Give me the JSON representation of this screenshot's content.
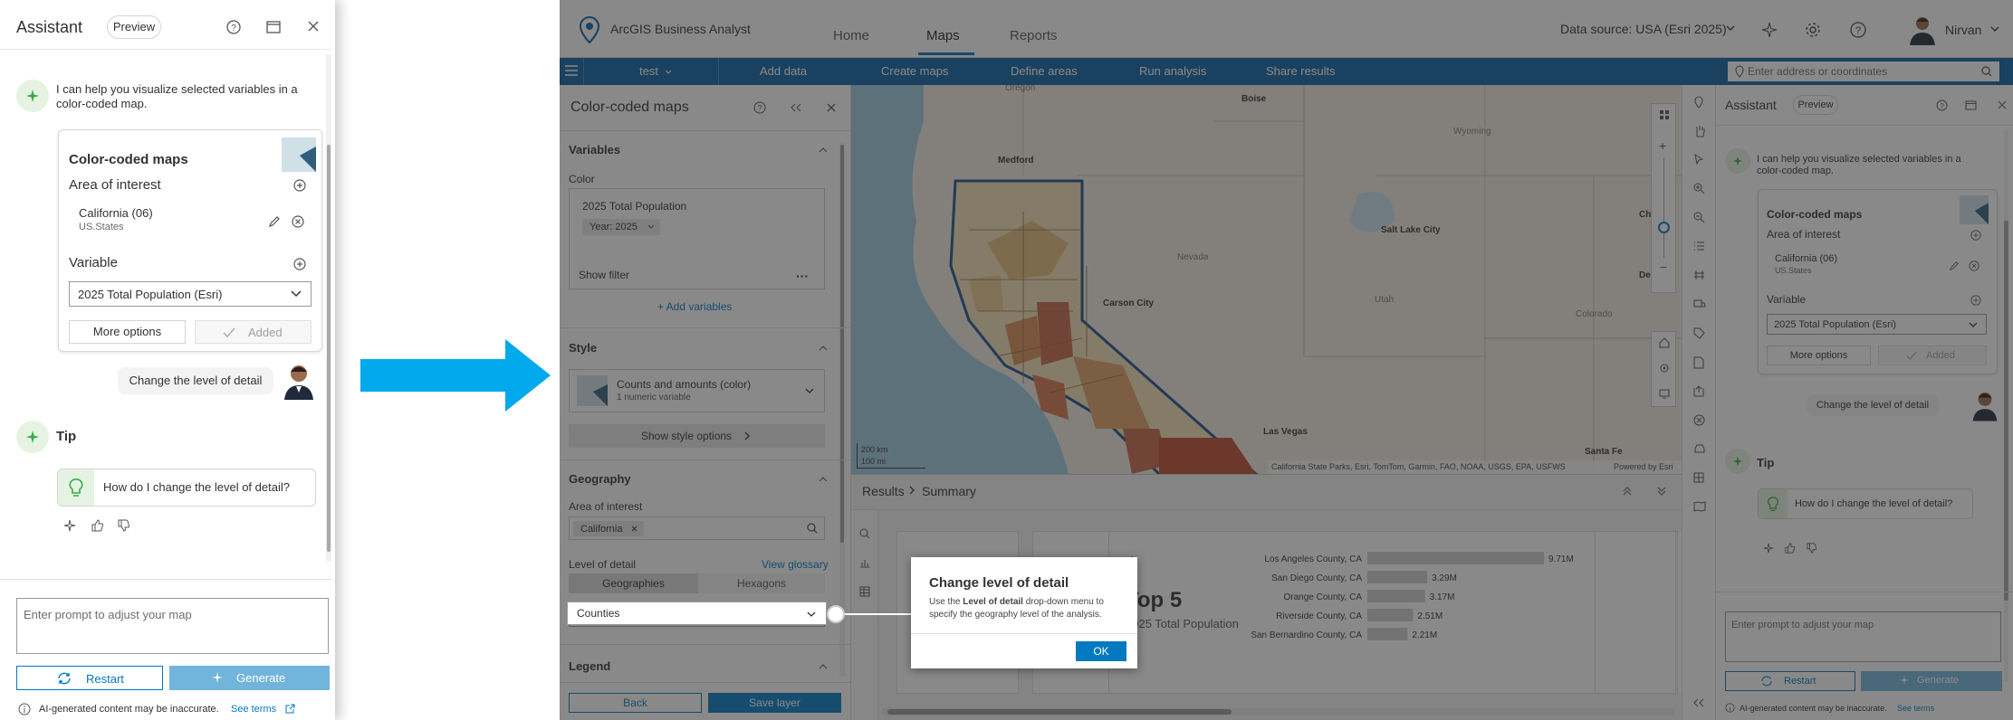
{
  "left_assistant": {
    "title": "Assistant",
    "preview_label": "Preview",
    "message": "I can help you visualize selected variables in a color-coded map.",
    "card": {
      "title": "Color-coded maps",
      "area_label": "Area of interest",
      "area_value": "California (06)",
      "area_sub": "US.States",
      "variable_label": "Variable",
      "variable_value": "2025 Total Population (Esri)",
      "more_options": "More options",
      "added": "Added"
    },
    "user_message": "Change the level of detail",
    "tip_title": "Tip",
    "tip_question": "How do I change the level of detail?",
    "prompt_placeholder": "Enter prompt to adjust your map",
    "restart": "Restart",
    "generate": "Generate",
    "disclaimer": "AI-generated content may be inaccurate.",
    "see_terms": "See terms"
  },
  "app": {
    "brand": "ArcGIS Business Analyst",
    "tabs": [
      "Home",
      "Maps",
      "Reports"
    ],
    "active_tab": "Maps",
    "data_source": "Data source: USA (Esri 2025)",
    "user_name": "Nirvan",
    "nav": {
      "project": "test",
      "items": [
        "Add data",
        "Create maps",
        "Define areas",
        "Run analysis",
        "Share results"
      ],
      "search_placeholder": "Enter address or coordinates"
    },
    "colors": {
      "nav_blue": "#0a5fa3",
      "accent_blue": "#0079c1",
      "ai_green": "#35ac46",
      "map_outline": "#1f4f8f"
    }
  },
  "ccm": {
    "title": "Color-coded maps",
    "variables_header": "Variables",
    "color_label": "Color",
    "var_name": "2025 Total Population",
    "year_chip": "Year: 2025",
    "show_filter": "Show filter",
    "add_variables": "+ Add variables",
    "style_header": "Style",
    "style_name": "Counts and amounts (color)",
    "style_sub": "1 numeric variable",
    "show_style_options": "Show style options",
    "geography_header": "Geography",
    "area_label": "Area of interest",
    "area_chip": "California",
    "level_label": "Level of detail",
    "view_glossary": "View glossary",
    "seg_geographies": "Geographies",
    "seg_hexagons": "Hexagons",
    "level_value": "Counties",
    "legend_header": "Legend",
    "back": "Back",
    "save_layer": "Save layer"
  },
  "map": {
    "labels": {
      "oregon": "Oregon",
      "boise": "Boise",
      "wyoming": "Wyoming",
      "medford": "Medford",
      "salt_lake": "Salt Lake City",
      "cheyenne": "Cheye",
      "nevada": "Nevada",
      "carson": "Carson City",
      "utah": "Utah",
      "denver": "Denver",
      "colorado": "Colorado",
      "las_vegas": "Las Vegas",
      "santa_fe": "Santa Fe"
    },
    "scale_km": "200 km",
    "scale_mi": "100 mi",
    "attribution": "California State Parks, Esri, TomTom, Garmin, FAO, NOAA, USGS, EPA, USFWS",
    "powered_by": "Powered by Esri"
  },
  "results": {
    "breadcrumb_results": "Results",
    "breadcrumb_summary": "Summary",
    "top5_title": "Top 5",
    "top5_sub": "2025 Total Population",
    "chart_data": {
      "type": "bar",
      "categories": [
        "Los Angeles County, CA",
        "San Diego County, CA",
        "Orange County, CA",
        "Riverside County, CA",
        "San Bernardino County, CA"
      ],
      "values": [
        9.71,
        3.29,
        3.17,
        2.51,
        2.21
      ],
      "value_labels": [
        "9.71M",
        "3.29M",
        "3.17M",
        "2.51M",
        "2.21M"
      ]
    }
  },
  "right_assistant": {
    "title": "Assistant",
    "preview_label": "Preview",
    "message": "I can help you visualize selected variables in a color-coded map.",
    "card_title": "Color-coded maps",
    "area_label": "Area of interest",
    "area_value": "California (06)",
    "area_sub": "US.States",
    "variable_label": "Variable",
    "variable_value": "2025 Total Population (Esri)",
    "more_options": "More options",
    "added": "Added",
    "user_message": "Change the level of detail",
    "tip_title": "Tip",
    "tip_question": "How do I change the level of detail?",
    "prompt_placeholder": "Enter prompt to adjust your map",
    "restart": "Restart",
    "generate": "Generate",
    "disclaimer": "AI-generated content may be inaccurate.",
    "see_terms": "See terms"
  },
  "dialog": {
    "title": "Change level of detail",
    "body_prefix": "Use the ",
    "body_bold": "Level of detail",
    "body_suffix": " drop-down menu to specify the geography level of the analysis.",
    "ok": "OK"
  }
}
